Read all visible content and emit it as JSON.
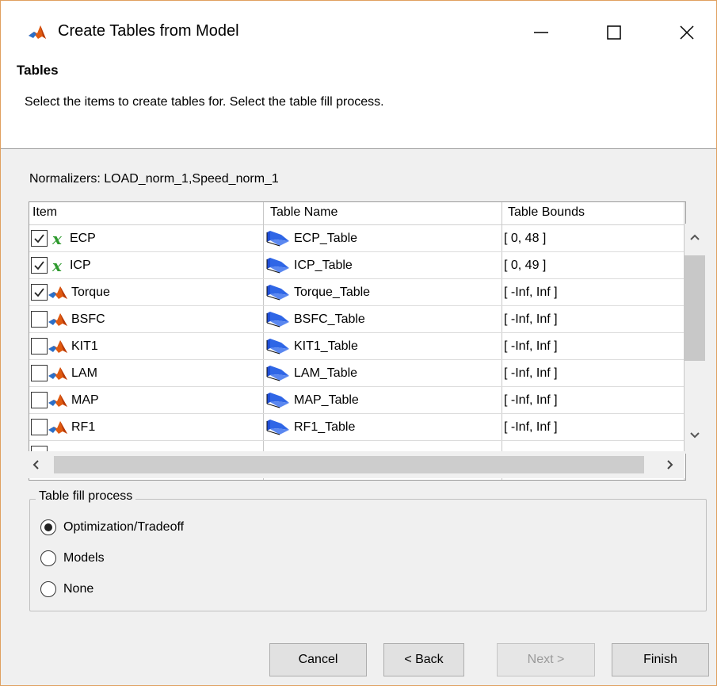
{
  "window": {
    "title": "Create Tables from Model",
    "app_icon": "matlab-icon"
  },
  "titlebar_buttons": {
    "minimize": "minimize",
    "maximize": "maximize",
    "close": "close"
  },
  "header": {
    "title": "Tables",
    "description": "Select the items to create tables for. Select the table fill process."
  },
  "normalizers": "Normalizers: LOAD_norm_1,Speed_norm_1",
  "table": {
    "columns": [
      "Item",
      "Table Name",
      "Table Bounds"
    ],
    "rows": [
      {
        "checked": true,
        "icon": "x-variable-icon",
        "item": "ECP",
        "table_name": "ECP_Table",
        "bounds": "[ 0, 48 ]"
      },
      {
        "checked": true,
        "icon": "x-variable-icon",
        "item": "ICP",
        "table_name": "ICP_Table",
        "bounds": "[ 0, 49 ]"
      },
      {
        "checked": true,
        "icon": "matlab-model-icon",
        "item": "Torque",
        "table_name": "Torque_Table",
        "bounds": "[ -Inf, Inf ]"
      },
      {
        "checked": false,
        "icon": "matlab-model-icon",
        "item": "BSFC",
        "table_name": "BSFC_Table",
        "bounds": "[ -Inf, Inf ]"
      },
      {
        "checked": false,
        "icon": "matlab-model-icon",
        "item": "KIT1",
        "table_name": "KIT1_Table",
        "bounds": "[ -Inf, Inf ]"
      },
      {
        "checked": false,
        "icon": "matlab-model-icon",
        "item": "LAM",
        "table_name": "LAM_Table",
        "bounds": "[ -Inf, Inf ]"
      },
      {
        "checked": false,
        "icon": "matlab-model-icon",
        "item": "MAP",
        "table_name": "MAP_Table",
        "bounds": "[ -Inf, Inf ]"
      },
      {
        "checked": false,
        "icon": "matlab-model-icon",
        "item": "RF1",
        "table_name": "RF1_Table",
        "bounds": "[ -Inf, Inf ]"
      }
    ]
  },
  "fill_process": {
    "legend": "Table fill process",
    "options": [
      "Optimization/Tradeoff",
      "Models",
      "None"
    ],
    "selected": "Optimization/Tradeoff"
  },
  "buttons": {
    "cancel": "Cancel",
    "back": "< Back",
    "next": "Next >",
    "finish": "Finish"
  },
  "colors": {
    "window_border": "#e0a060",
    "x_icon": "#2e9a2e",
    "matlab_orange": "#e05a10",
    "table_icon_blue": "#1f4fd8"
  }
}
